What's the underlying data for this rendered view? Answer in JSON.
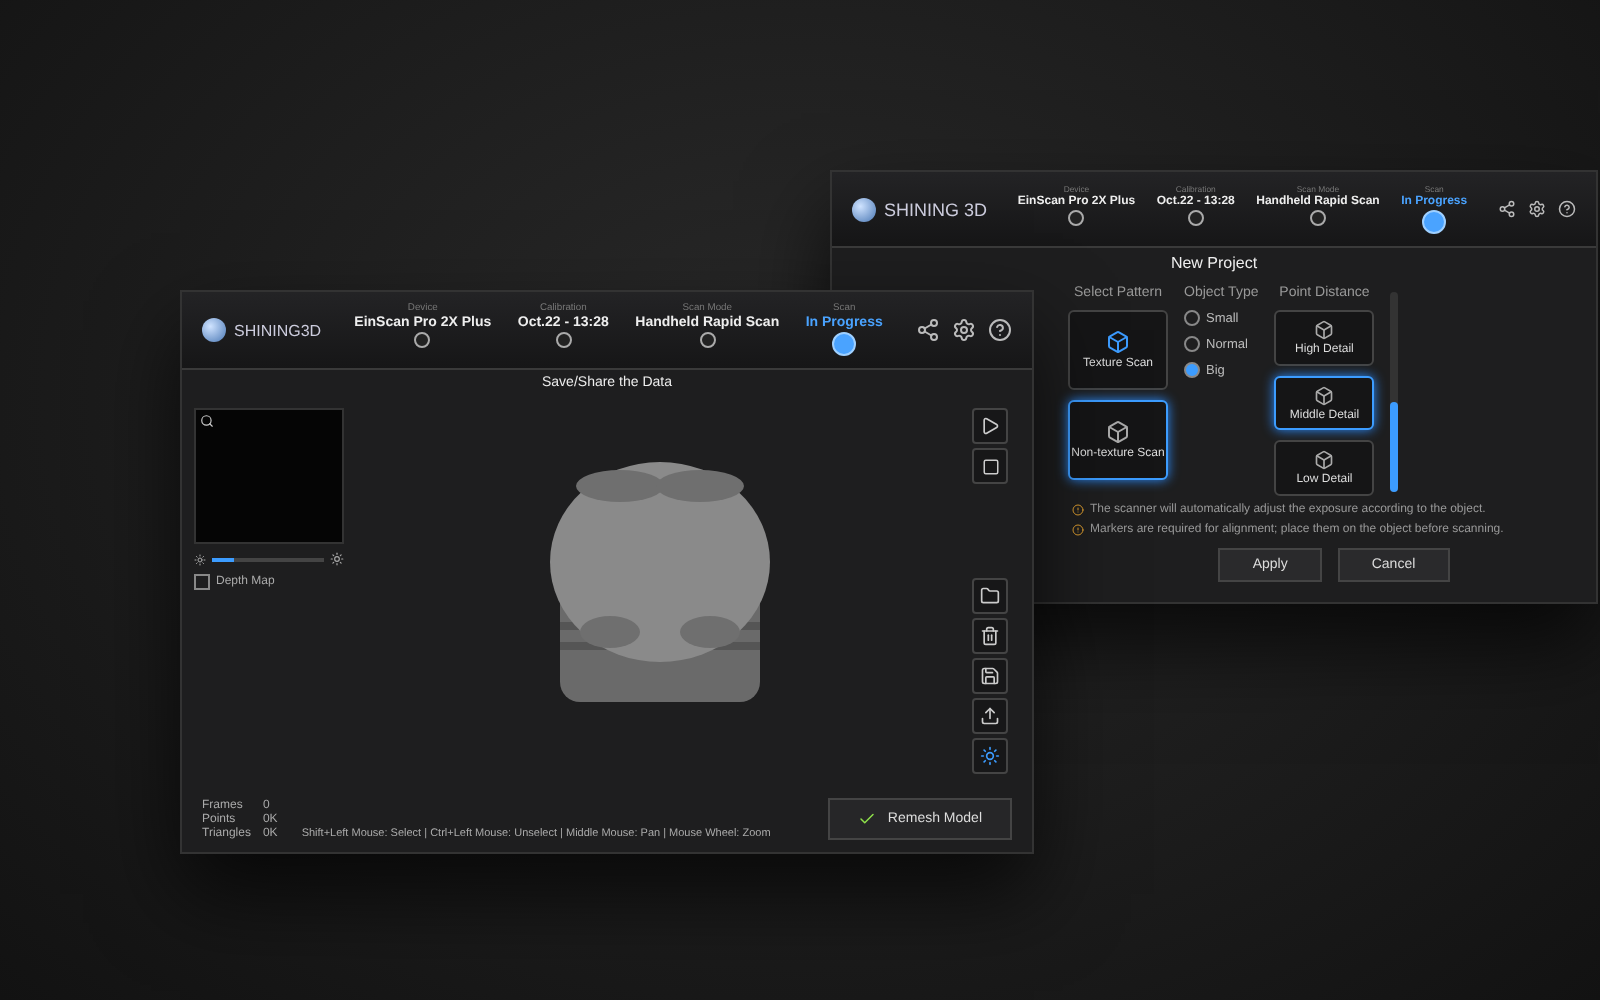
{
  "back_window": {
    "logo": "SHINING 3D",
    "steps": [
      {
        "label": "Device",
        "value": "EinScan Pro 2X Plus",
        "selected": false
      },
      {
        "label": "Calibration",
        "value": "Oct.22 - 13:28",
        "selected": false
      },
      {
        "label": "Scan Mode",
        "value": "Handheld Rapid Scan",
        "selected": false
      },
      {
        "label": "Scan",
        "value": "In Progress",
        "selected": true
      }
    ],
    "title": "New Project",
    "pattern_title": "Select Pattern",
    "patterns": [
      {
        "label": "Texture Scan",
        "selected": false
      },
      {
        "label": "Non-texture Scan",
        "selected": true
      }
    ],
    "object_title": "Object Type",
    "object_options": [
      {
        "label": "Small",
        "selected": false
      },
      {
        "label": "Normal",
        "selected": false
      },
      {
        "label": "Big",
        "selected": true
      }
    ],
    "detail_title": "Point Distance",
    "details": [
      {
        "label": "High Detail",
        "selected": false
      },
      {
        "label": "Middle Detail",
        "selected": true
      },
      {
        "label": "Low Detail",
        "selected": false
      }
    ],
    "detail_slider": {
      "level": 0.45
    },
    "notes": [
      "The scanner will automatically adjust the exposure according to the object.",
      "Markers are required for alignment; place them on the object before scanning."
    ],
    "buttons": [
      "Apply",
      "Cancel"
    ]
  },
  "front_window": {
    "logo": "SHINING3D",
    "steps": [
      {
        "label": "Device",
        "value": "EinScan Pro 2X Plus",
        "selected": false
      },
      {
        "label": "Calibration",
        "value": "Oct.22 - 13:28",
        "selected": false
      },
      {
        "label": "Scan Mode",
        "value": "Handheld Rapid Scan",
        "selected": false
      },
      {
        "label": "Scan",
        "value": "In Progress",
        "selected": true
      }
    ],
    "subtitle": "Save/Share the Data",
    "brightness_slider": {
      "level": 0.2
    },
    "preview_option": {
      "label": "Depth Map",
      "checked": false
    },
    "stats": [
      {
        "label": "Frames",
        "value": "0"
      },
      {
        "label": "Points",
        "value": "0K"
      },
      {
        "label": "Triangles",
        "value": "0K"
      }
    ],
    "hint": "Shift+Left Mouse: Select | Ctrl+Left Mouse: Unselect | Middle Mouse: Pan | Mouse Wheel: Zoom",
    "finish_button": "Remesh Model"
  }
}
